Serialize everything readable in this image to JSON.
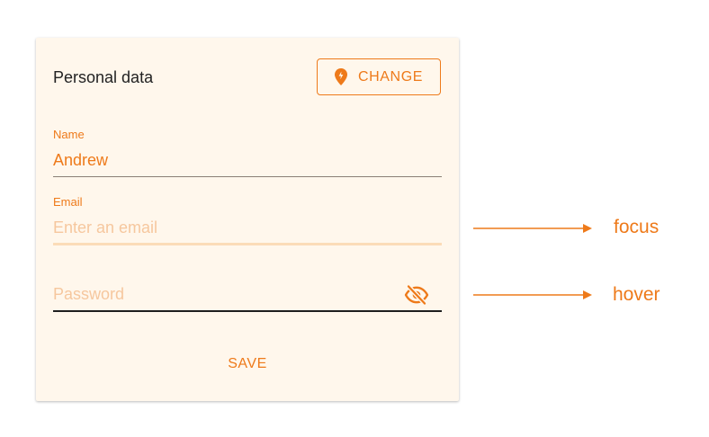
{
  "form": {
    "title": "Personal data",
    "change_button_label": "CHANGE",
    "change_button_icon": "location-pin-icon",
    "name": {
      "label": "Name",
      "value": "Andrew"
    },
    "email": {
      "label": "Email",
      "placeholder": "Enter an email",
      "state": "focus"
    },
    "password": {
      "placeholder": "Password",
      "toggle_icon": "eye-off-icon",
      "state": "hover"
    },
    "save_button_label": "SAVE"
  },
  "annotations": {
    "focus_label": "focus",
    "hover_label": "hover"
  },
  "colors": {
    "accent": "#ee7a1a",
    "accent_light": "#f6c79e",
    "card_background": "#fff7ec",
    "text_dark": "#222222"
  }
}
